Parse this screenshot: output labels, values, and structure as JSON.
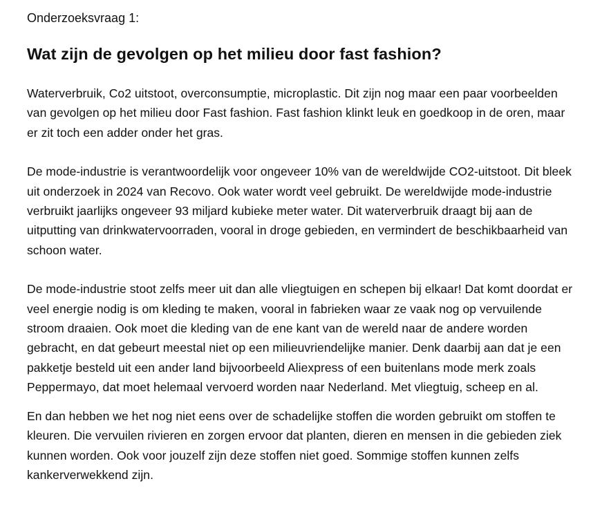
{
  "document": {
    "label": "Onderzoeksvraag 1:",
    "heading": "Wat zijn de gevolgen op het milieu door fast fashion?",
    "paragraphs": [
      "Waterverbruik, Co2 uitstoot, overconsumptie, microplastic. Dit zijn nog maar een paar voorbeelden van gevolgen op het milieu door Fast fashion. Fast fashion klinkt leuk en goedkoop in de oren, maar er zit toch een adder onder het gras.",
      "De mode-industrie is verantwoordelijk voor ongeveer 10% van de wereldwijde CO2-uitstoot. Dit bleek uit onderzoek in 2024 van Recovo. Ook water wordt veel gebruikt. De wereldwijde mode-industrie verbruikt jaarlijks ongeveer 93 miljard kubieke meter water. Dit waterverbruik draagt bij aan de uitputting van drinkwatervoorraden, vooral in droge gebieden, en vermindert de beschikbaarheid van schoon water.",
      "De mode-industrie stoot zelfs meer uit dan alle vliegtuigen en schepen bij elkaar! Dat komt doordat er veel energie nodig is om kleding te maken, vooral in fabrieken waar ze vaak nog op vervuilende stroom draaien. Ook moet die kleding van de ene kant van de wereld naar de andere worden gebracht, en dat gebeurt meestal niet op een milieuvriendelijke manier. Denk daarbij aan dat je een pakketje besteld uit een ander land bijvoorbeeld Aliexpress of een buitenlans mode merk zoals Peppermayo, dat moet helemaal vervoerd worden naar Nederland. Met vliegtuig, scheep en al.",
      "En dan hebben we het nog niet eens over de schadelijke stoffen die worden gebruikt om stoffen te kleuren. Die vervuilen rivieren en zorgen ervoor dat planten, dieren en mensen in die gebieden ziek kunnen worden. Ook voor jouzelf zijn deze stoffen niet goed. Sommige stoffen kunnen zelfs kankerverwekkend zijn."
    ]
  }
}
